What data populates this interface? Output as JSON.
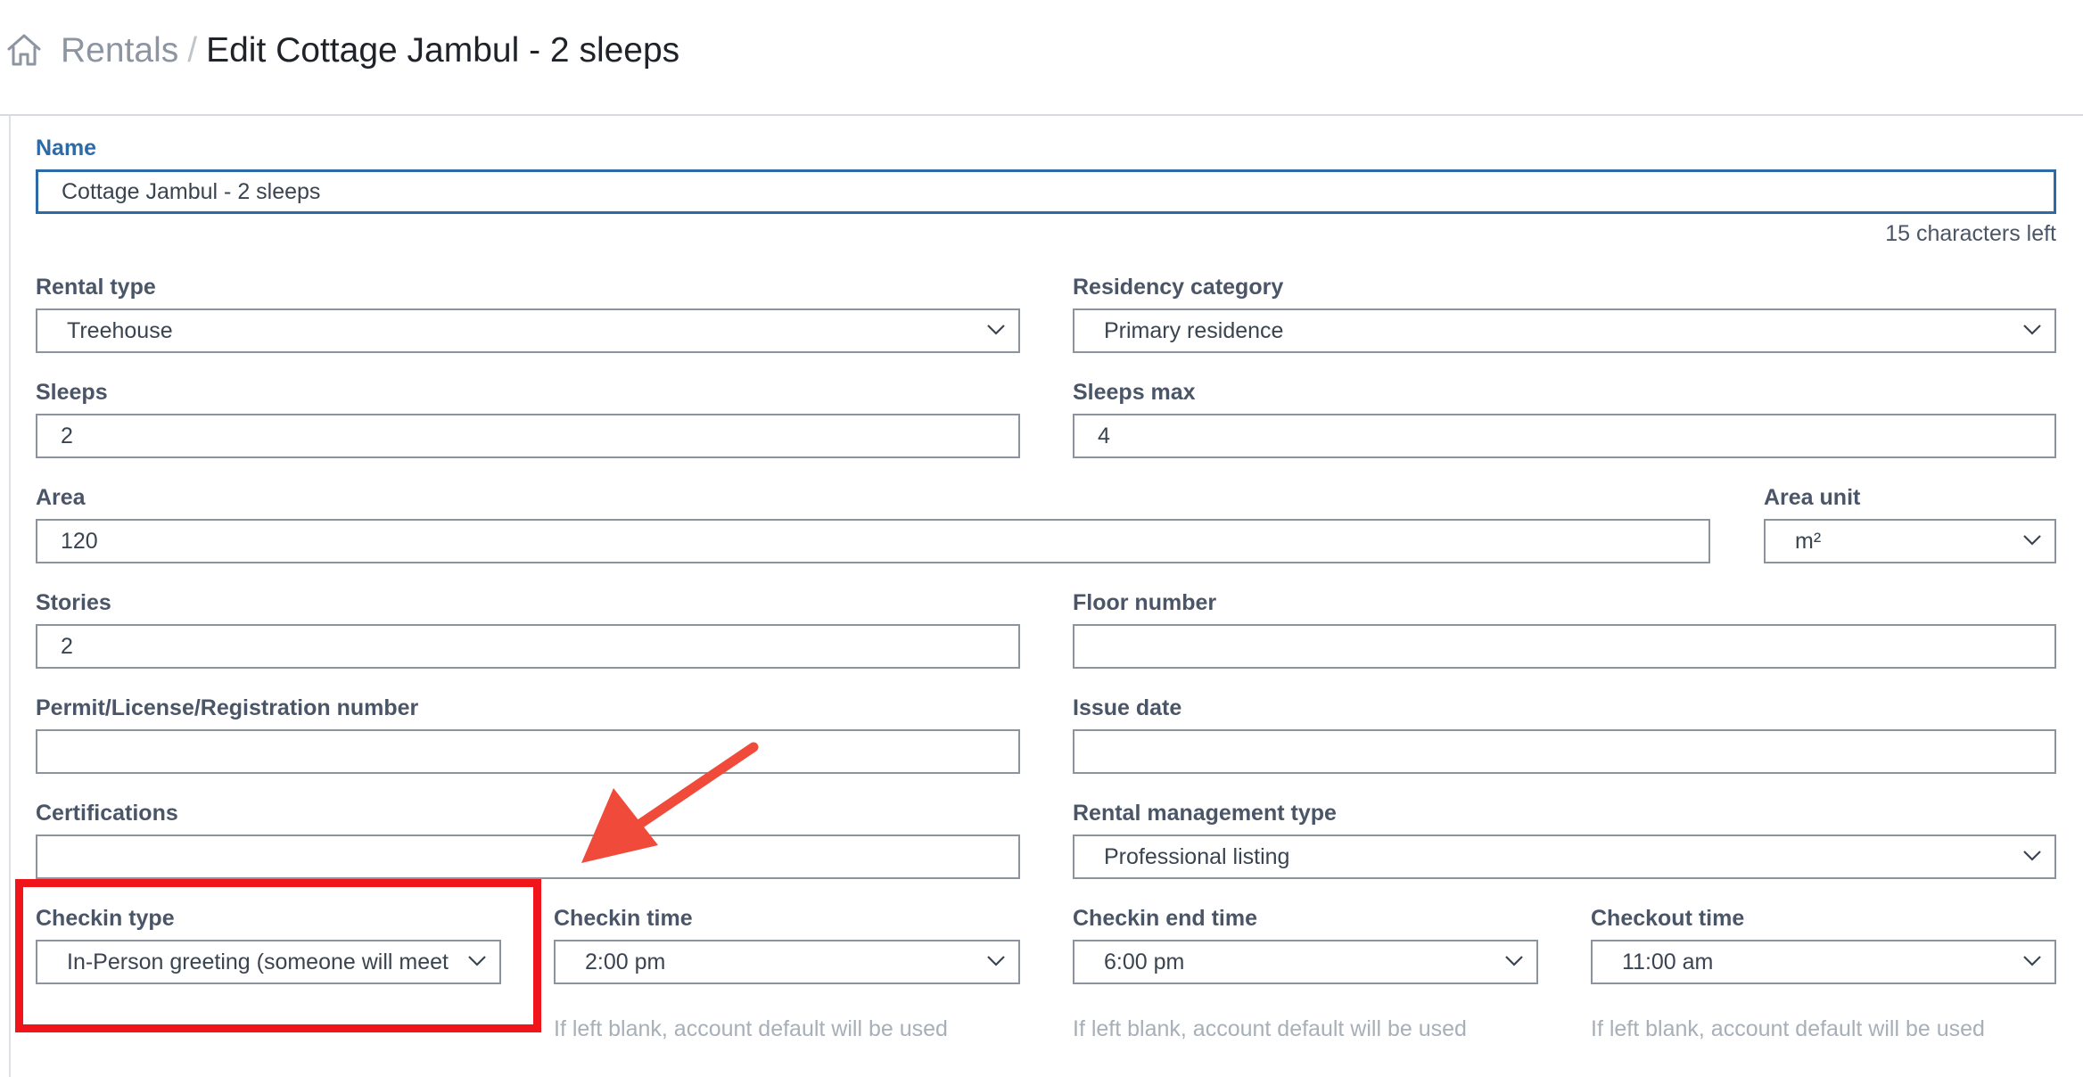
{
  "header": {
    "breadcrumb_parent": "Rentals",
    "breadcrumb_separator": "/",
    "breadcrumb_current": "Edit Cottage Jambul - 2 sleeps"
  },
  "form": {
    "name": {
      "label": "Name",
      "value": "Cottage Jambul - 2 sleeps",
      "counter": "15 characters left"
    },
    "rental_type": {
      "label": "Rental type",
      "value": "Treehouse"
    },
    "residency_category": {
      "label": "Residency category",
      "value": "Primary residence"
    },
    "sleeps": {
      "label": "Sleeps",
      "value": "2"
    },
    "sleeps_max": {
      "label": "Sleeps max",
      "value": "4"
    },
    "area": {
      "label": "Area",
      "value": "120"
    },
    "area_unit": {
      "label": "Area unit",
      "value": "m²"
    },
    "stories": {
      "label": "Stories",
      "value": "2"
    },
    "floor_number": {
      "label": "Floor number",
      "value": ""
    },
    "permit": {
      "label": "Permit/License/Registration number",
      "value": ""
    },
    "issue_date": {
      "label": "Issue date",
      "value": ""
    },
    "certifications": {
      "label": "Certifications",
      "value": ""
    },
    "rental_management_type": {
      "label": "Rental management type",
      "value": "Professional listing"
    },
    "checkin_type": {
      "label": "Checkin type",
      "value": "In-Person greeting (someone will meet"
    },
    "checkin_time": {
      "label": "Checkin time",
      "value": "2:00 pm",
      "helper": "If left blank, account default will be used"
    },
    "checkin_end_time": {
      "label": "Checkin end time",
      "value": "6:00 pm",
      "helper": "If left blank, account default will be used"
    },
    "checkout_time": {
      "label": "Checkout time",
      "value": "11:00 am",
      "helper": "If left blank, account default will be used"
    }
  },
  "colors": {
    "focus_blue": "#2c6aa8",
    "annotation_red": "#f0141b",
    "arrow_red": "#f04a3a"
  },
  "icons": {
    "home": "home-icon",
    "dropdown": "chevron-down-icon"
  }
}
